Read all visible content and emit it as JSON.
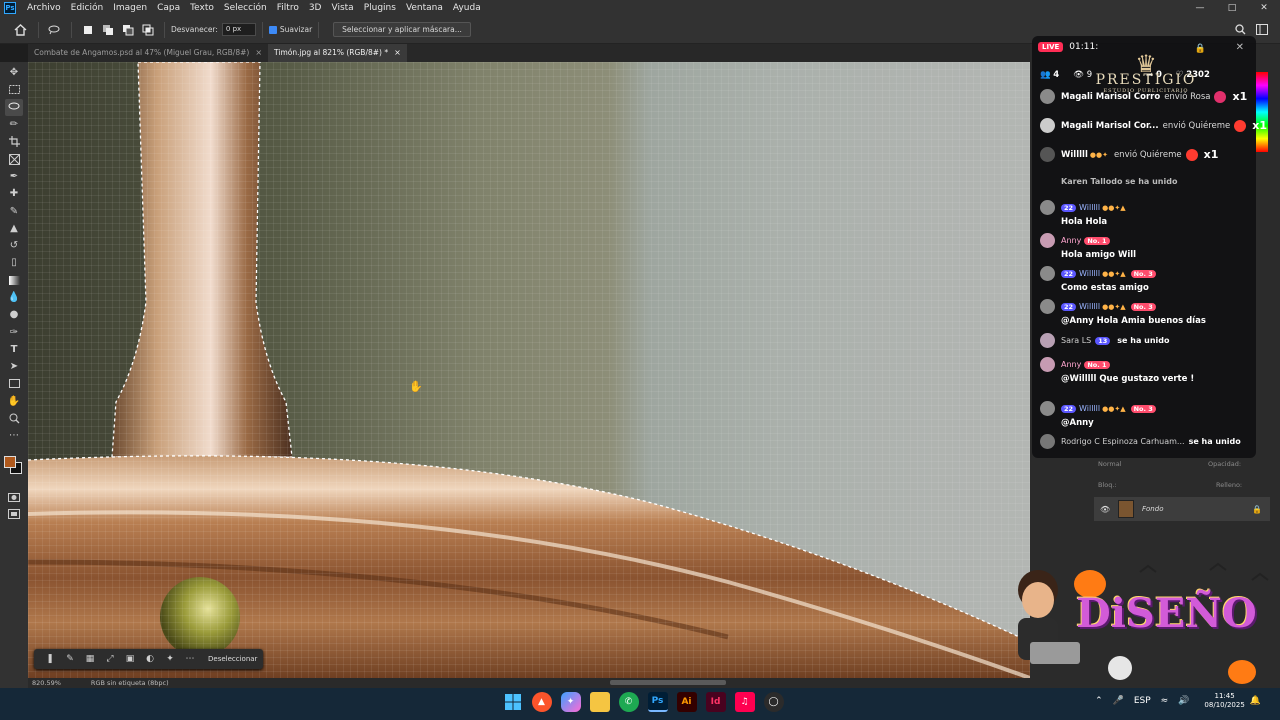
{
  "menubar": {
    "logo": "Ps",
    "items": [
      "Archivo",
      "Edición",
      "Imagen",
      "Capa",
      "Texto",
      "Selección",
      "Filtro",
      "3D",
      "Vista",
      "Plugins",
      "Ventana",
      "Ayuda"
    ]
  },
  "options": {
    "feather_label": "Desvanecer:",
    "feather_value": "0 px",
    "antialias_label": "Suavizar",
    "select_mask_button": "Seleccionar y aplicar máscara..."
  },
  "tabs": [
    {
      "label": "Combate de Angamos.psd al 47% (Miguel Grau, RGB/8#)",
      "close": "×"
    },
    {
      "label": "Timón.jpg al 821% (RGB/8#) *",
      "close": "×"
    }
  ],
  "tools": [
    "move-tool",
    "marquee-tool",
    "lasso-tool",
    "quick-select-tool",
    "crop-tool",
    "frame-tool",
    "eyedropper-tool",
    "healing-tool",
    "brush-tool",
    "stamp-tool",
    "history-brush-tool",
    "eraser-tool",
    "gradient-tool",
    "blur-tool",
    "dodge-tool",
    "pen-tool",
    "type-tool",
    "path-select-tool",
    "rectangle-tool",
    "hand-tool",
    "zoom-tool",
    "more-tools"
  ],
  "foreground_color": "#b0591c",
  "background_color": "#111111",
  "context_bar": {
    "deselect": "Deseleccionar"
  },
  "status": {
    "zoom": "820.59%",
    "profile": "RGB sin etiqueta (8bpc)"
  },
  "layers": {
    "blend_mode": "Normal",
    "opacity_label": "Opacidad:",
    "fill_label": "Relleno:",
    "lock_label": "Bloq.:",
    "layer_name": "Fondo"
  },
  "live": {
    "badge": "LIVE",
    "timer": "01:11:",
    "stats": {
      "viewers": "4",
      "likes_count": "0",
      "hearts": "2302"
    },
    "brand": {
      "name": "PRESTIGIO",
      "tagline": "ESTUDIO PUBLICITARIO"
    },
    "gifts": [
      {
        "user": "Magali Marisol Corro",
        "verb": "envió Rosa",
        "mult": "x1"
      },
      {
        "user": "Magali Marisol Cor...",
        "verb": "envió Quiéreme",
        "mult": "x1"
      },
      {
        "user": "Willlll",
        "verb": "envió Quiéreme",
        "mult": "x1"
      }
    ],
    "partial_line": "Karen Tallodo se ha unido",
    "chat": [
      {
        "level": "22",
        "user": "Willlll",
        "msg": "Hola Hola",
        "no": ""
      },
      {
        "level": "",
        "user": "Anny",
        "msg": "Hola amigo Will",
        "no": "No. 1"
      },
      {
        "level": "22",
        "user": "Willlll",
        "msg": "Como estas amigo",
        "no": "No. 3"
      },
      {
        "level": "22",
        "user": "Willlll",
        "msg": "@Anny Hola Amia buenos días",
        "no": "No. 3"
      },
      {
        "level": "13",
        "user": "Sara LS",
        "msg": "se ha unido",
        "no": ""
      },
      {
        "level": "",
        "user": "Anny",
        "msg": "@Willlll Que gustazo verte !",
        "no": "No. 1"
      },
      {
        "level": "22",
        "user": "Willlll",
        "msg": "@Anny",
        "no": "No. 3"
      },
      {
        "level": "",
        "user": "Rodrigo C Espinoza Carhuam...",
        "msg": "se ha unido",
        "no": ""
      }
    ]
  },
  "sticker_text": "DiSEÑO",
  "taskbar": {
    "lang": "ESP",
    "time": "11:45",
    "date": "08/10/2025"
  }
}
